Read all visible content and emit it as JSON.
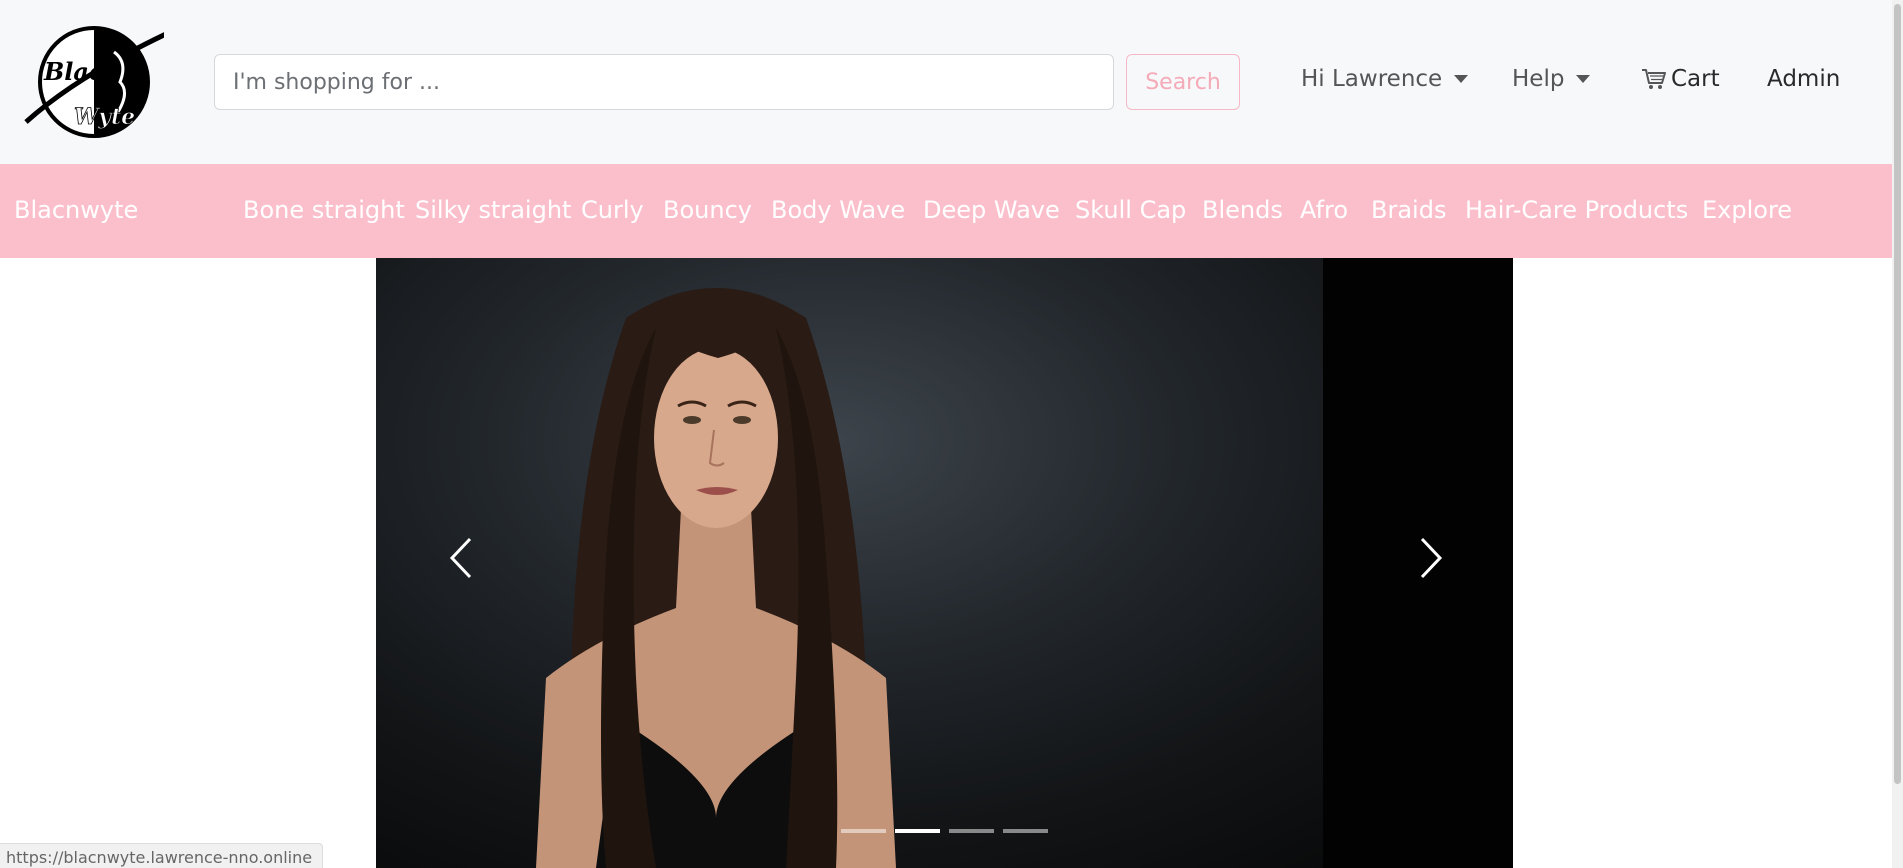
{
  "header": {
    "logo_text": "Blac n Wyte",
    "search": {
      "placeholder": "I'm shopping for ...",
      "value": "",
      "button_label": "Search"
    },
    "user_menu_label": "Hi Lawrence",
    "help_menu_label": "Help",
    "cart_label": "Cart",
    "admin_label": "Admin"
  },
  "category_nav": {
    "brand": "Blacnwyte",
    "items": [
      {
        "label": "Bone straight"
      },
      {
        "label": "Silky straight"
      },
      {
        "label": "Curly"
      },
      {
        "label": "Bouncy"
      },
      {
        "label": "Body Wave"
      },
      {
        "label": "Deep Wave"
      },
      {
        "label": "Skull Cap"
      },
      {
        "label": "Blends"
      },
      {
        "label": "Afro"
      },
      {
        "label": "Braids"
      },
      {
        "label": "Hair-Care Products"
      },
      {
        "label": "Explore"
      }
    ]
  },
  "carousel": {
    "slide_count": 4,
    "active_index": 1,
    "icons": {
      "prev": "chevron-left-icon",
      "next": "chevron-right-icon"
    }
  },
  "status_bar": {
    "url": "https://blacnwyte.lawrence-nno.online"
  },
  "colors": {
    "category_bar": "#fbbfcc",
    "search_button": "#f5aab8",
    "header_bg": "#f7f8fa"
  }
}
